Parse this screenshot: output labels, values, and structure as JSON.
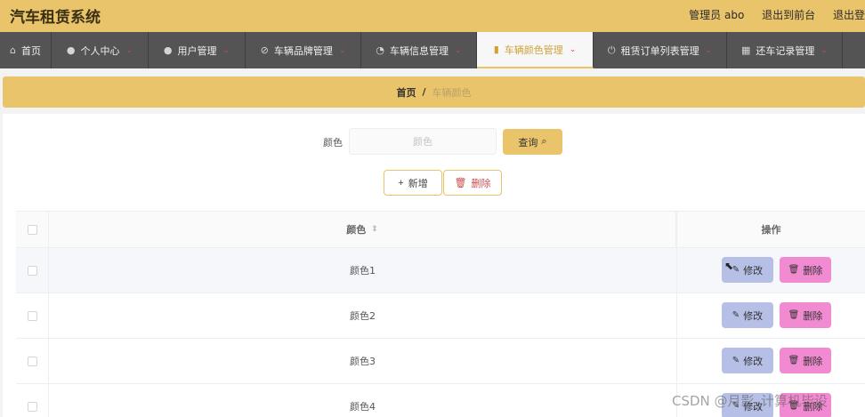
{
  "app": {
    "title": "汽车租赁系统"
  },
  "header": {
    "admin_label": "管理员 abo",
    "back_to_front": "退出到前台",
    "logout": "退出登"
  },
  "nav": {
    "items": [
      {
        "label": "首页",
        "icon": "home-icon"
      },
      {
        "label": "个人中心",
        "icon": "user-icon"
      },
      {
        "label": "用户管理",
        "icon": "user-icon"
      },
      {
        "label": "车辆品牌管理",
        "icon": "brand-icon"
      },
      {
        "label": "车辆信息管理",
        "icon": "info-icon"
      },
      {
        "label": "车辆颜色管理",
        "icon": "bar-chart-icon",
        "active": true
      },
      {
        "label": "租赁订单列表管理",
        "icon": "power-icon"
      },
      {
        "label": "还车记录管理",
        "icon": "grid-icon"
      }
    ]
  },
  "breadcrumb": {
    "home": "首页",
    "separator": "/",
    "current": "车辆颜色"
  },
  "search": {
    "label": "颜色",
    "placeholder": "颜色",
    "button": "查询"
  },
  "actions": {
    "add": "新增",
    "delete": "删除"
  },
  "table": {
    "headers": {
      "color": "颜色",
      "ops": "操作"
    },
    "rows": [
      {
        "color": "颜色1",
        "edit": "修改",
        "delete": "删除"
      },
      {
        "color": "颜色2",
        "edit": "修改",
        "delete": "删除"
      },
      {
        "color": "颜色3",
        "edit": "修改",
        "delete": "删除"
      },
      {
        "color": "颜色4",
        "edit": "修改",
        "delete": "删除"
      }
    ]
  },
  "watermark": "CSDN @月影_计算机毕设",
  "colors": {
    "accent": "#e9c46a",
    "nav_bg": "#545454",
    "edit_btn": "#b6bfe6",
    "delete_btn": "#f18ad1"
  }
}
